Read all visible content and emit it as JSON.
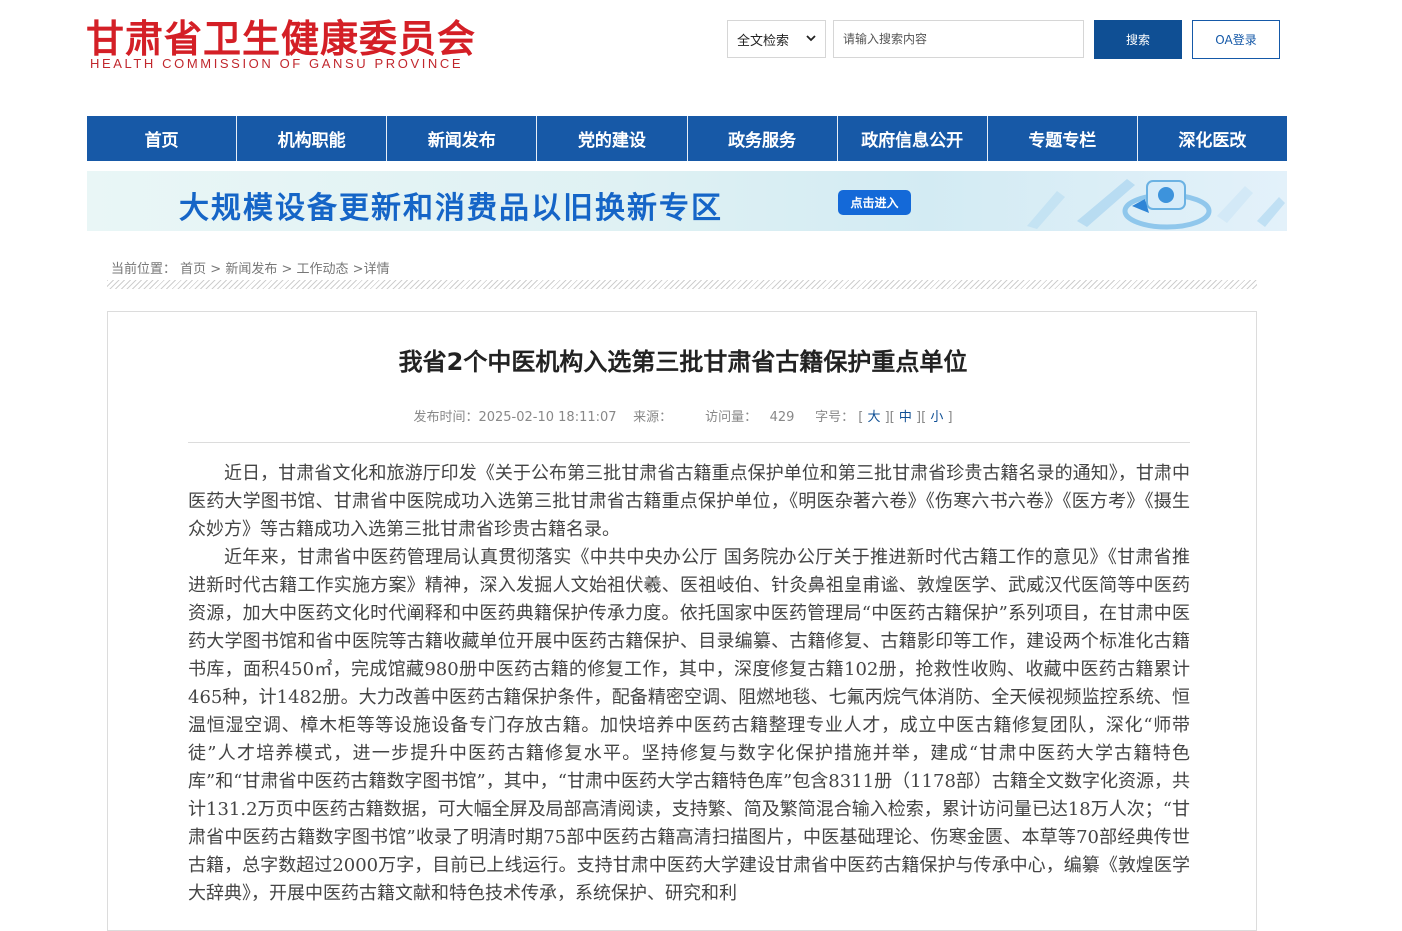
{
  "header": {
    "logo_cn": "甘肃省卫生健康委员会",
    "logo_en": "HEALTH COMMISSION OF GANSU PROVINCE",
    "search_type": "全文检索",
    "search_placeholder": "请输入搜索内容",
    "search_button": "搜索",
    "oa_button": "OA登录"
  },
  "nav": {
    "items": [
      "首页",
      "机构职能",
      "新闻发布",
      "党的建设",
      "政务服务",
      "政府信息公开",
      "专题专栏",
      "深化医改"
    ]
  },
  "banner": {
    "title": "大规模设备更新和消费品以旧换新专区",
    "button": "点击进入"
  },
  "breadcrumb": {
    "label": "当前位置：",
    "home": "首页",
    "sep1": " > ",
    "news": "新闻发布",
    "sep2": " > ",
    "work": "工作动态",
    "sep3": " >",
    "detail": "详情"
  },
  "article": {
    "title": "我省2个中医机构入选第三批甘肃省古籍保护重点单位",
    "meta_time_label": "发布时间：",
    "meta_time": "2025-02-10 18:11:07",
    "meta_source_label": "来源：",
    "meta_visits_label": "访问量：",
    "meta_visits": "429",
    "meta_font_label": "字号：",
    "font_large": "大",
    "font_medium": "中",
    "font_small": "小",
    "paragraphs": [
      "近日，甘肃省文化和旅游厅印发《关于公布第三批甘肃省古籍重点保护单位和第三批甘肃省珍贵古籍名录的通知》，甘肃中医药大学图书馆、甘肃省中医院成功入选第三批甘肃省古籍重点保护单位，《明医杂著六卷》《伤寒六书六卷》《医方考》《摄生众妙方》等古籍成功入选第三批甘肃省珍贵古籍名录。",
      "近年来，甘肃省中医药管理局认真贯彻落实《中共中央办公厅 国务院办公厅关于推进新时代古籍工作的意见》《甘肃省推进新时代古籍工作实施方案》精神，深入发掘人文始祖伏羲、医祖岐伯、针灸鼻祖皇甫谧、敦煌医学、武威汉代医简等中医药资源，加大中医药文化时代阐释和中医药典籍保护传承力度。依托国家中医药管理局“中医药古籍保护”系列项目，在甘肃中医药大学图书馆和省中医院等古籍收藏单位开展中医药古籍保护、目录编纂、古籍修复、古籍影印等工作，建设两个标准化古籍书库，面积450㎡，完成馆藏980册中医药古籍的修复工作，其中，深度修复古籍102册，抢救性收购、收藏中医药古籍累计465种，计1482册。大力改善中医药古籍保护条件，配备精密空调、阻燃地毯、七氟丙烷气体消防、全天候视频监控系统、恒温恒湿空调、樟木柜等等设施设备专门存放古籍。加快培养中医药古籍整理专业人才，成立中医古籍修复团队，深化“师带徒”人才培养模式，进一步提升中医药古籍修复水平。坚持修复与数字化保护措施并举，建成“甘肃中医药大学古籍特色库”和“甘肃省中医药古籍数字图书馆”，其中，“甘肃中医药大学古籍特色库”包含8311册（1178部）古籍全文数字化资源，共计131.2万页中医药古籍数据，可大幅全屏及局部高清阅读，支持繁、简及繁简混合输入检索，累计访问量已达18万人次；“甘肃省中医药古籍数字图书馆”收录了明清时期75部中医药古籍高清扫描图片，中医基础理论、伤寒金匮、本草等70部经典传世古籍，总字数超过2000万字，目前已上线运行。支持甘肃中医药大学建设甘肃省中医药古籍保护与传承中心，编纂《敦煌医学大辞典》，开展中医药古籍文献和特色技术传承，系统保护、研究和利"
    ]
  },
  "colors": {
    "brand_red": "#d41f26",
    "nav_blue": "#1759a7",
    "button_blue": "#0f4f94",
    "banner_title": "#1565c7"
  },
  "icons": {
    "select_chevron": "chevron-down-icon",
    "banner_illustration": "device-update-illustration"
  }
}
